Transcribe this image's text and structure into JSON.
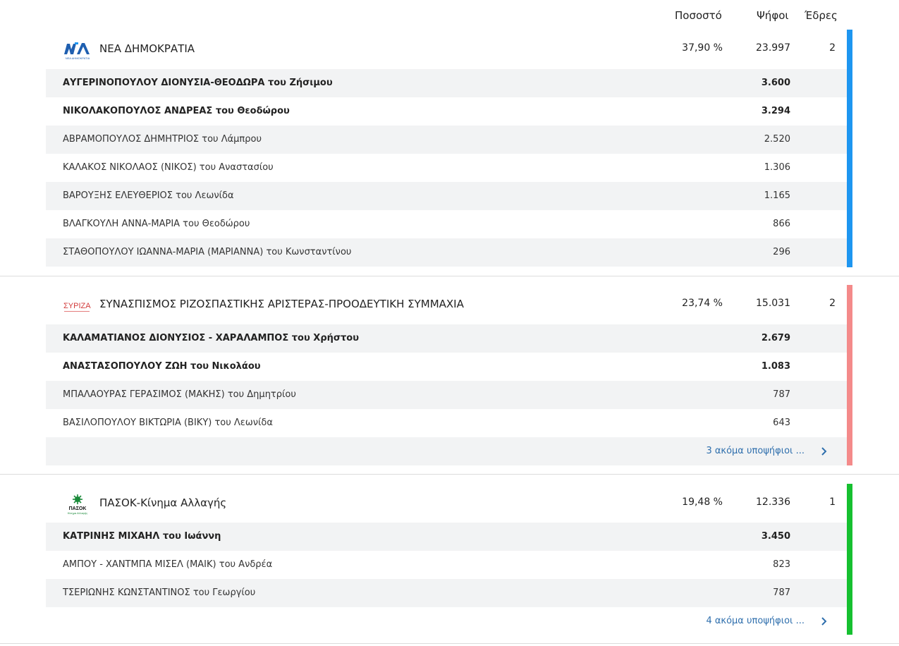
{
  "columns": {
    "percent": "Ποσοστό",
    "votes": "Ψήφοι",
    "seats": "Έδρες"
  },
  "parties": [
    {
      "name": "ΝΕΑ ΔΗΜΟΚΡΑΤΙΑ",
      "logo_text": "ΝΑ",
      "logo_sub": "ΝΕΑ ΔΗΜΟΚΡΑΤΙΑ",
      "percent": "37,90 %",
      "votes": "23.997",
      "seats": "2",
      "color": "#1e96f0",
      "candidates": [
        {
          "name": "ΑΥΓΕΡΙΝΟΠΟΥΛΟΥ ΔΙΟΝΥΣΙΑ-ΘΕΟΔΩΡΑ του Ζήσιμου",
          "votes": "3.600",
          "elected": true
        },
        {
          "name": "ΝΙΚΟΛΑΚΟΠΟΥΛΟΣ ΑΝΔΡΕΑΣ του Θεοδώρου",
          "votes": "3.294",
          "elected": true
        },
        {
          "name": "ΑΒΡΑΜΟΠΟΥΛΟΣ ΔΗΜΗΤΡΙΟΣ του Λάμπρου",
          "votes": "2.520",
          "elected": false
        },
        {
          "name": "ΚΑΛΑΚΟΣ ΝΙΚΟΛΑΟΣ (ΝΙΚΟΣ) του Αναστασίου",
          "votes": "1.306",
          "elected": false
        },
        {
          "name": "ΒΑΡΟΥΞΗΣ ΕΛΕΥΘΕΡΙΟΣ του Λεωνίδα",
          "votes": "1.165",
          "elected": false
        },
        {
          "name": "ΒΛΑΓΚΟΥΛΗ ΑΝΝΑ-ΜΑΡΙΑ του Θεοδώρου",
          "votes": "866",
          "elected": false
        },
        {
          "name": "ΣΤΑΘΟΠΟΥΛΟΥ ΙΩΑΝΝΑ-ΜΑΡΙΑ (ΜΑΡΙΑΝΝΑ) του Κωνσταντίνου",
          "votes": "296",
          "elected": false
        }
      ],
      "more": ""
    },
    {
      "name": "ΣΥΝΑΣΠΙΣΜΟΣ ΡΙΖΟΣΠΑΣΤΙΚΗΣ ΑΡΙΣΤΕΡΑΣ-ΠΡΟΟΔΕΥΤΙΚΗ ΣΥΜΜΑΧΙΑ",
      "logo_text": "ΣΥΡΙΖΑ",
      "logo_sub": "",
      "percent": "23,74 %",
      "votes": "15.031",
      "seats": "2",
      "color": "#f48a8a",
      "candidates": [
        {
          "name": "ΚΑΛΑΜΑΤΙΑΝΟΣ ΔΙΟΝΥΣΙΟΣ - ΧΑΡΑΛΑΜΠΟΣ του Χρήστου",
          "votes": "2.679",
          "elected": true
        },
        {
          "name": "ΑΝΑΣΤΑΣΟΠΟΥΛΟΥ ΖΩΗ του Νικολάου",
          "votes": "1.083",
          "elected": true
        },
        {
          "name": "ΜΠΑΛΑΟΥΡΑΣ ΓΕΡΑΣΙΜΟΣ (ΜΑΚΗΣ) του Δημητρίου",
          "votes": "787",
          "elected": false
        },
        {
          "name": "ΒΑΣΙΛΟΠΟΥΛΟΥ ΒΙΚΤΩΡΙΑ (ΒΙΚΥ) του Λεωνίδα",
          "votes": "643",
          "elected": false
        }
      ],
      "more": "3 ακόμα υποψήφιοι ..."
    },
    {
      "name": "ΠΑΣΟΚ-Κίνημα Αλλαγής",
      "logo_text": "ΠΑΣΟΚ",
      "logo_sub": "Κίνημα Αλλαγής",
      "percent": "19,48 %",
      "votes": "12.336",
      "seats": "1",
      "color": "#16c030",
      "candidates": [
        {
          "name": "ΚΑΤΡΙΝΗΣ ΜΙΧΑΗΛ του Ιωάννη",
          "votes": "3.450",
          "elected": true
        },
        {
          "name": "ΑΜΠΟΥ - ΧΑΝΤΜΠΑ ΜΙΣΕΛ (ΜΑΙΚ) του Ανδρέα",
          "votes": "823",
          "elected": false
        },
        {
          "name": "ΤΣΕΡΙΩΝΗΣ ΚΩΝΣΤΑΝΤΙΝΟΣ του Γεωργίου",
          "votes": "787",
          "elected": false
        }
      ],
      "more": "4 ακόμα υποψήφιοι ..."
    }
  ]
}
